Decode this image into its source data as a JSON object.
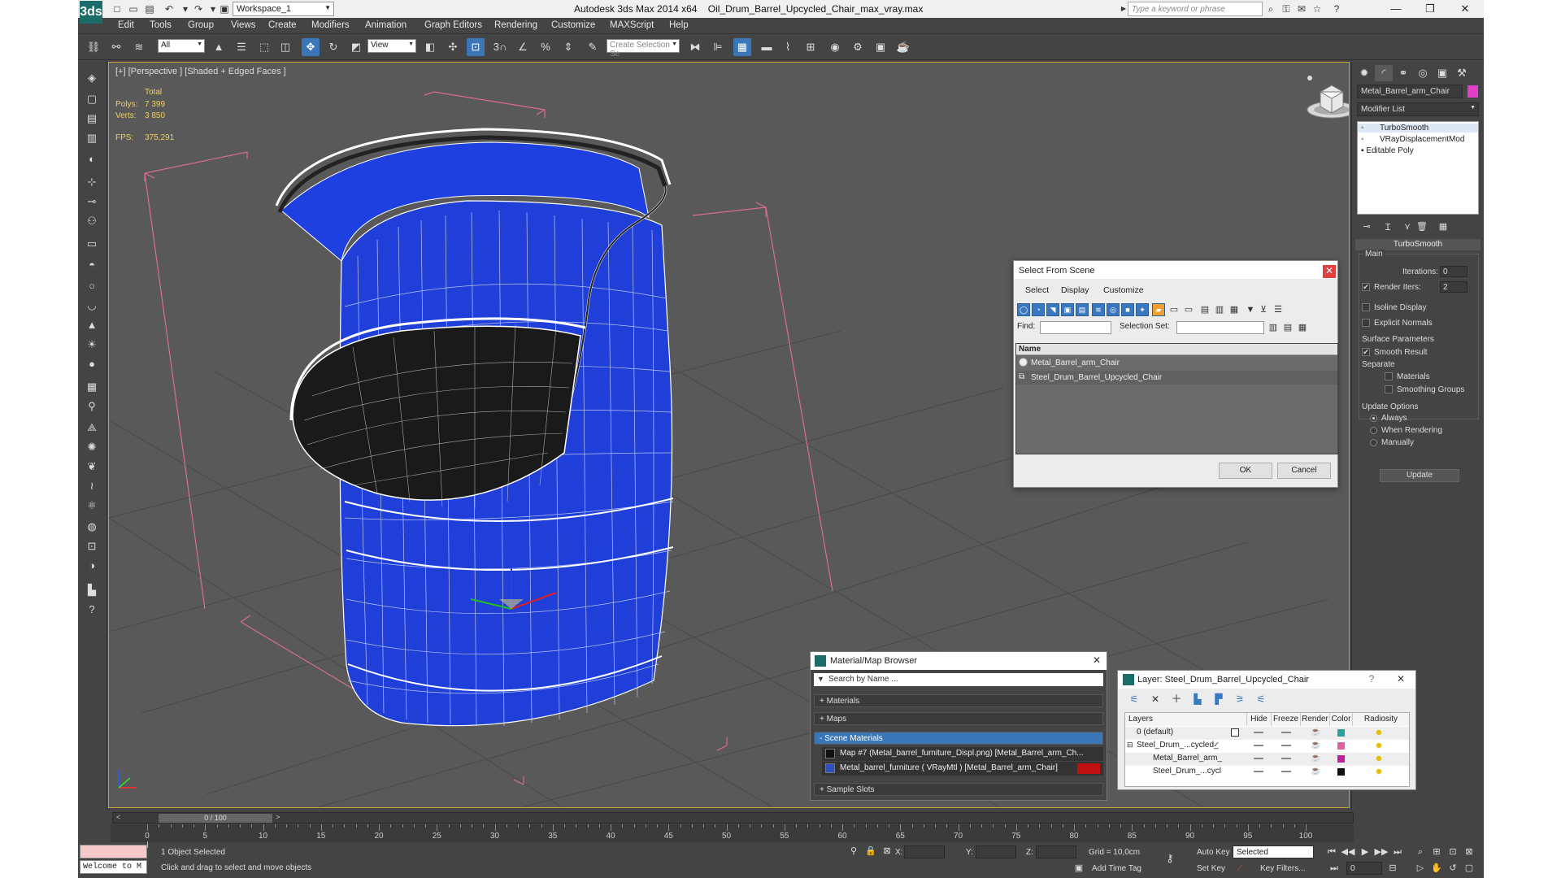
{
  "titlebar": {
    "logo": "3ds",
    "workspace": "Workspace_1",
    "app_title": "Autodesk 3ds Max  2014 x64",
    "file_name": "Oil_Drum_Barrel_Upcycled_Chair_max_vray.max",
    "search_placeholder": "Type a keyword or phrase"
  },
  "menu": [
    "Edit",
    "Tools",
    "Group",
    "Views",
    "Create",
    "Modifiers",
    "Animation",
    "Graph Editors",
    "Rendering",
    "Customize",
    "MAXScript",
    "Help"
  ],
  "toolbar": {
    "filter_value": "All",
    "refcoord_value": "View",
    "num3": "3",
    "named_sel_placeholder": "Create Selection Se"
  },
  "viewport": {
    "label": "[+] [Perspective ] [Shaded + Edged Faces ]",
    "stats": {
      "total_label": "Total",
      "polys_label": "Polys:",
      "polys_value": "7 399",
      "verts_label": "Verts:",
      "verts_value": "3 850",
      "fps_label": "FPS:",
      "fps_value": "375,291"
    }
  },
  "command_panel": {
    "object_name": "Metal_Barrel_arm_Chair",
    "object_color": "#e040c8",
    "modifier_list": "Modifier List",
    "stack": [
      "TurboSmooth",
      "VRayDisplacementMod",
      "Editable Poly"
    ],
    "rollout_title": "TurboSmooth",
    "main_label": "Main",
    "iterations_label": "Iterations:",
    "iterations_value": "0",
    "render_iters_label": "Render Iters:",
    "render_iters_value": "2",
    "isoline_label": "Isoline Display",
    "explicit_normals_label": "Explicit Normals",
    "surface_params_label": "Surface Parameters",
    "smooth_result_label": "Smooth Result",
    "separate_label": "Separate",
    "materials_label": "Materials",
    "smoothing_groups_label": "Smoothing Groups",
    "update_options_label": "Update Options",
    "always_label": "Always",
    "when_rendering_label": "When Rendering",
    "manually_label": "Manually",
    "update_button": "Update"
  },
  "select_dialog": {
    "title": "Select From Scene",
    "menu": [
      "Select",
      "Display",
      "Customize"
    ],
    "find_label": "Find:",
    "selection_set_label": "Selection Set:",
    "name_header": "Name",
    "items": [
      "Metal_Barrel_arm_Chair",
      "Steel_Drum_Barrel_Upcycled_Chair"
    ],
    "ok": "OK",
    "cancel": "Cancel"
  },
  "material_browser": {
    "title": "Material/Map Browser",
    "search_placeholder": "Search by Name ...",
    "sections": [
      "+ Materials",
      "+ Maps",
      "- Scene Materials",
      "+ Sample Slots"
    ],
    "scene_materials": [
      "Map #7 (Metal_barrel_furniture_Displ.png) [Metal_Barrel_arm_Ch...",
      "Metal_barrel_furniture  ( VRayMtl ) [Metal_Barrel_arm_Chair]"
    ]
  },
  "layer_dialog": {
    "title": "Layer: Steel_Drum_Barrel_Upcycled_Chair",
    "help": "?",
    "columns": [
      "Layers",
      "Hide",
      "Freeze",
      "Render",
      "Color",
      "Radiosity"
    ],
    "rows": [
      {
        "name": "0 (default)",
        "color": "#2aa0a0"
      },
      {
        "name": "Steel_Drum_...cycled_",
        "color": "#e060a0"
      },
      {
        "name": "Metal_Barrel_arm_",
        "color": "#c020a0"
      },
      {
        "name": "Steel_Drum_...cycl",
        "color": "#101010"
      }
    ]
  },
  "timeline": {
    "slider_label": "0 / 100",
    "ticks": [
      "0",
      "5",
      "10",
      "15",
      "20",
      "25",
      "30",
      "35",
      "40",
      "45",
      "50",
      "55",
      "60",
      "65",
      "70",
      "75",
      "80",
      "85",
      "90",
      "95",
      "100"
    ]
  },
  "status": {
    "listener": "Welcome to M",
    "objects_selected": "1 Object Selected",
    "prompt": "Click and drag to select and move objects",
    "x_label": "X:",
    "y_label": "Y:",
    "z_label": "Z:",
    "grid": "Grid = 10,0cm",
    "auto_key": "Auto Key",
    "selected_dd": "Selected",
    "set_key": "Set Key",
    "key_filters": "Key Filters...",
    "add_time_tag": "Add Time Tag",
    "frame_value": "0"
  }
}
